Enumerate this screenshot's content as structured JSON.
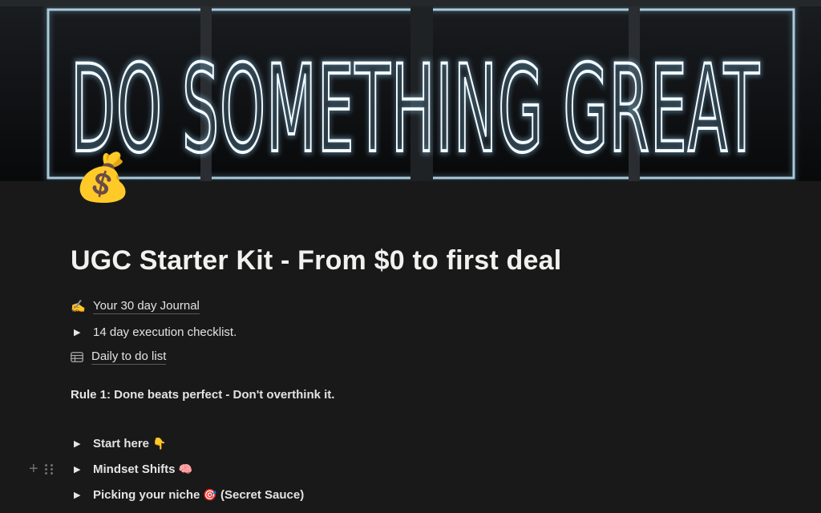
{
  "cover": {
    "neon_words": [
      "DO",
      "SOMETHING",
      "GREAT"
    ],
    "colors": {
      "background": "#0b0c0e",
      "neon": "#f4fbff",
      "glow": "#8fd6ff"
    }
  },
  "page": {
    "icon": "💰",
    "icon_name": "money-bag-icon",
    "title": "UGC Starter Kit - From $0 to first deal"
  },
  "blocks": {
    "journal": {
      "icon": "✍️",
      "label": "Your 30 day Journal"
    },
    "checklist": {
      "arrow": "▶",
      "label": "14 day execution checklist."
    },
    "todo": {
      "icon": "table-icon",
      "label": "Daily to do list"
    },
    "rule": {
      "label": "Rule 1: Done beats perfect - Don't overthink it."
    },
    "start": {
      "arrow": "▶",
      "label": "Start here",
      "emoji": "👇"
    },
    "mindset": {
      "arrow": "▶",
      "label": "Mindset Shifts",
      "emoji": "🧠"
    },
    "niche": {
      "arrow": "▶",
      "label": "Picking your niche",
      "emoji": "🎯",
      "suffix": " (Secret Sauce)"
    }
  },
  "hover_controls": {
    "add_icon": "+",
    "drag_icon": "drag-handle-icon"
  },
  "theme": {
    "background": "#191919",
    "text": "#e6e6e4"
  }
}
